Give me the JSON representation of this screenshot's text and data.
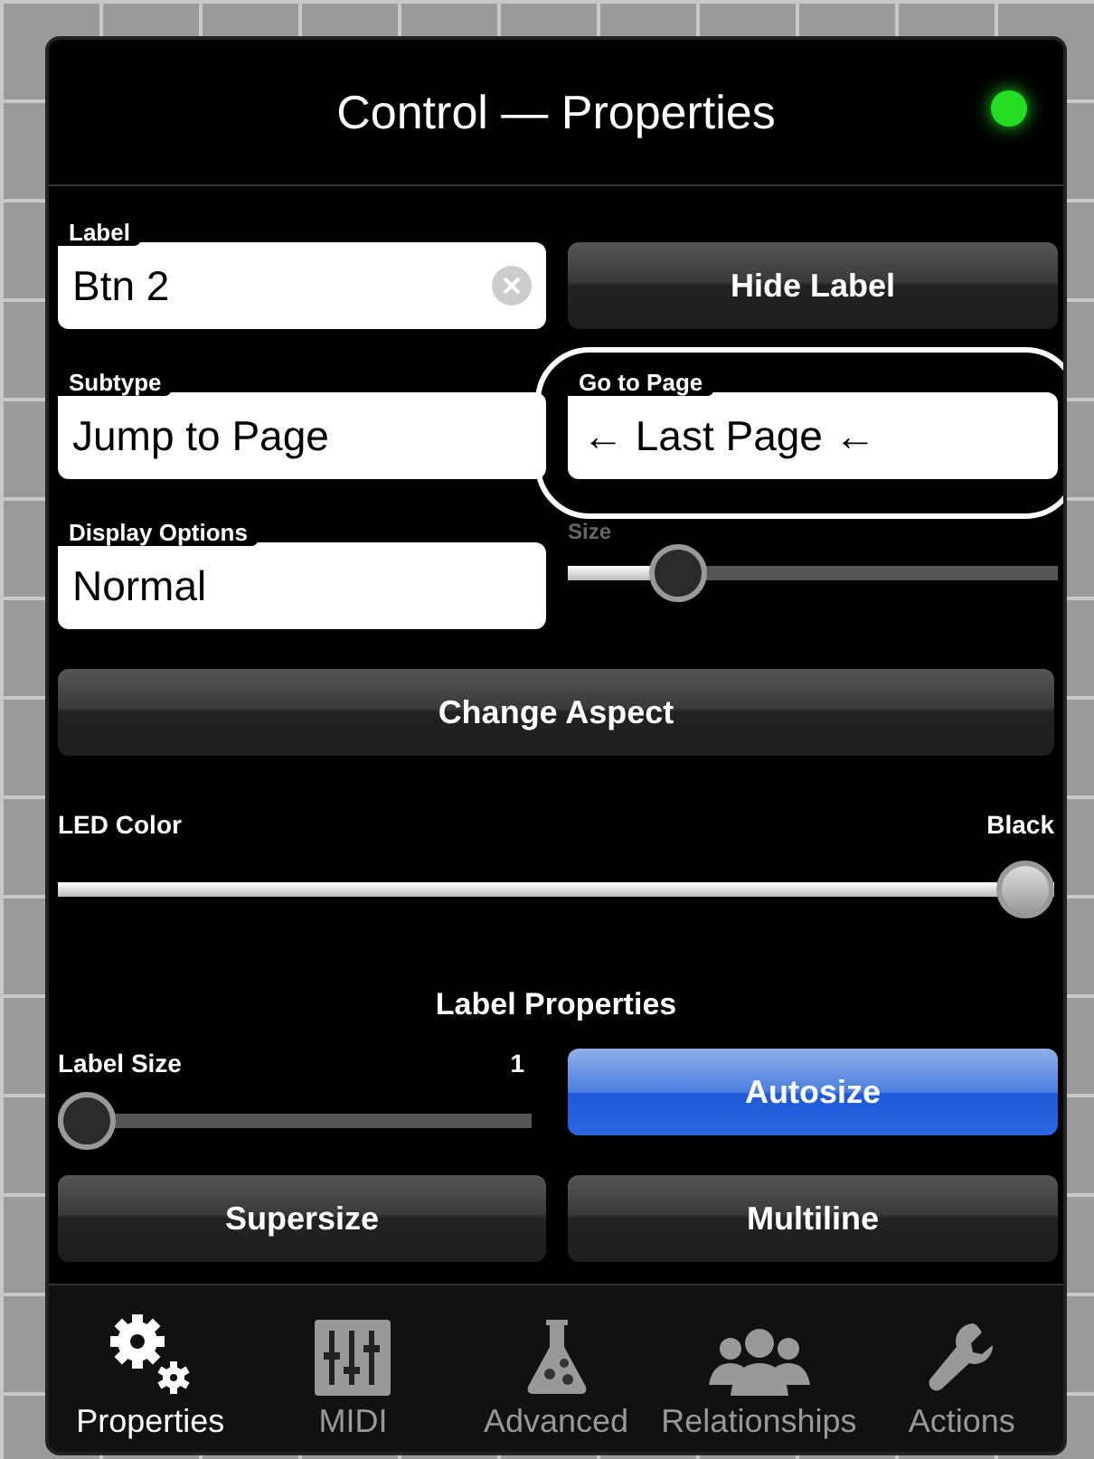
{
  "header": {
    "title": "Control — Properties",
    "status_led": {
      "on": true,
      "color": "#22dd22"
    }
  },
  "fields": [
    {
      "label": "Label",
      "value": "Btn 2",
      "clearable": true
    },
    {
      "kind": "button",
      "label": "Hide Label",
      "selected": false
    },
    {
      "label": "Subtype",
      "value": "Jump to Page"
    },
    {
      "label": "Go to Page",
      "value": "← Last Page ←",
      "highlighted": true
    },
    {
      "label": "Display Options",
      "value": "Normal"
    },
    {
      "kind": "slider",
      "label": "Size",
      "level": 0.19
    }
  ],
  "change_aspect": {
    "label": "Change Aspect",
    "selected": false
  },
  "led_color": {
    "label": "LED Color",
    "reading": "Black",
    "level": 1
  },
  "label_properties": {
    "title": "Label Properties",
    "label_size": {
      "label": "Label Size",
      "reading": "1",
      "level": 0
    },
    "buttons": [
      {
        "label": "Autosize",
        "selected": true
      },
      {
        "label": "Supersize",
        "selected": false
      },
      {
        "label": "Multiline",
        "selected": false
      }
    ]
  },
  "tabs": [
    {
      "label": "Properties",
      "selected": true
    },
    {
      "label": "MIDI",
      "selected": false
    },
    {
      "label": "Advanced",
      "selected": false
    },
    {
      "label": "Relationships",
      "selected": false
    },
    {
      "label": "Actions",
      "selected": false
    }
  ]
}
